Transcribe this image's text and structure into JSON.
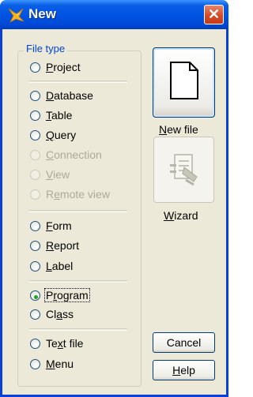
{
  "window": {
    "title": "New",
    "close_symbol": "✕",
    "icon": "new-doc-spark-icon"
  },
  "file_type": {
    "label": "File type",
    "options": [
      {
        "pre": "",
        "key": "P",
        "post": "roject",
        "enabled": true,
        "checked": false
      },
      {
        "pre": "",
        "key": "D",
        "post": "atabase",
        "enabled": true,
        "checked": false
      },
      {
        "pre": "",
        "key": "T",
        "post": "able",
        "enabled": true,
        "checked": false
      },
      {
        "pre": "",
        "key": "Q",
        "post": "uery",
        "enabled": true,
        "checked": false
      },
      {
        "pre": "",
        "key": "C",
        "post": "onnection",
        "enabled": false,
        "checked": false
      },
      {
        "pre": "",
        "key": "V",
        "post": "iew",
        "enabled": false,
        "checked": false
      },
      {
        "pre": "R",
        "key": "e",
        "post": "mote view",
        "enabled": false,
        "checked": false
      },
      {
        "pre": "",
        "key": "F",
        "post": "orm",
        "enabled": true,
        "checked": false
      },
      {
        "pre": "",
        "key": "R",
        "post": "eport",
        "enabled": true,
        "checked": false
      },
      {
        "pre": "",
        "key": "L",
        "post": "abel",
        "enabled": true,
        "checked": false
      },
      {
        "pre": "P",
        "key": "r",
        "post": "ogram",
        "enabled": true,
        "checked": true
      },
      {
        "pre": "Cl",
        "key": "a",
        "post": "ss",
        "enabled": true,
        "checked": false
      },
      {
        "pre": "Te",
        "key": "x",
        "post": "t file",
        "enabled": true,
        "checked": false
      },
      {
        "pre": "",
        "key": "M",
        "post": "enu",
        "enabled": true,
        "checked": false
      }
    ]
  },
  "buttons": {
    "new_file": {
      "key": "N",
      "post": "ew file",
      "icon": "blank-page-icon"
    },
    "wizard": {
      "key": "W",
      "post": "izard",
      "icon": "wizard-icon",
      "enabled": false
    },
    "cancel": {
      "label": "Cancel"
    },
    "help": {
      "key": "H",
      "post": "elp"
    }
  }
}
